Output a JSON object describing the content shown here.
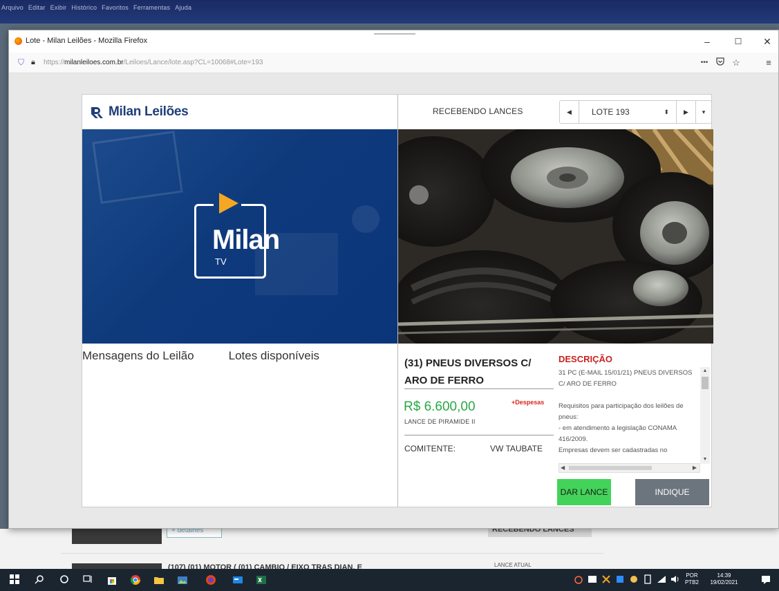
{
  "background": {
    "menubar_items": [
      "Arquivo",
      "Editar",
      "Exibir",
      "Histórico",
      "Favoritos",
      "Ferramentas",
      "Ajuda"
    ],
    "detalhes_button": "+ detalhes",
    "status_badge": "RECEBENDO LANCES",
    "next_lot_title": "(107)  (01) MOTOR ( (01) CAMBIO / EIXO TRAS DIAN. E",
    "lance_atual_label": "LANCE ATUAL"
  },
  "browser": {
    "window_title": "Lote - Milan Leilões - Mozilla Firefox",
    "url_prefix": "https://",
    "url_domain": "milanleiloes.com.br",
    "url_path": "/Leiloes/Lance/lote.asp?CL=10068#Lote=193",
    "page_actions_icon": "•••",
    "pocket_icon": "pocket-icon",
    "bookmark_icon": "star-icon",
    "menu_icon": "hamburger-menu-icon"
  },
  "brand": {
    "name": "Milan Leilões",
    "video_logo_word": "Milan",
    "video_logo_sub": "TV",
    "accent_color": "#1f3e7a",
    "play_color": "#f5a623"
  },
  "tabs": [
    "Mensagens do Leilão",
    "Lotes disponíveis"
  ],
  "lot_header": {
    "status": "RECEBENDO LANCES",
    "lot_select": "LOTE 193"
  },
  "lot": {
    "title": "(31) PNEUS DIVERSOS C/ ARO DE FERRO",
    "price": "R$ 6.600,00",
    "despesas": "+Despesas",
    "lance_type": "LANCE DE PIRAMIDE II",
    "comitente_label": "COMITENTE:",
    "comitente_value": "VW TAUBATE",
    "price_color": "#28a745",
    "despesas_color": "#d9261c"
  },
  "description": {
    "heading": "DESCRIÇÃO",
    "line1": "31 PC (E-MAIL 15/01/21) PNEUS DIVERSOS C/ ARO DE FERRO",
    "line2": "Requisitos para participação dos leilões de pneus:",
    "line3": "- em atendimento a legislação CONAMA 416/2009.",
    "line4": "Empresas devem ser cadastradas no"
  },
  "actions": {
    "bid_button": "DAR LANCE",
    "refer_button": "INDIQUE",
    "bid_color": "#44d35a",
    "refer_color": "#6c757d"
  },
  "taskbar": {
    "language": "POR",
    "language_sub": "PTB2",
    "time": "14:39",
    "date": "19/02/2021"
  }
}
